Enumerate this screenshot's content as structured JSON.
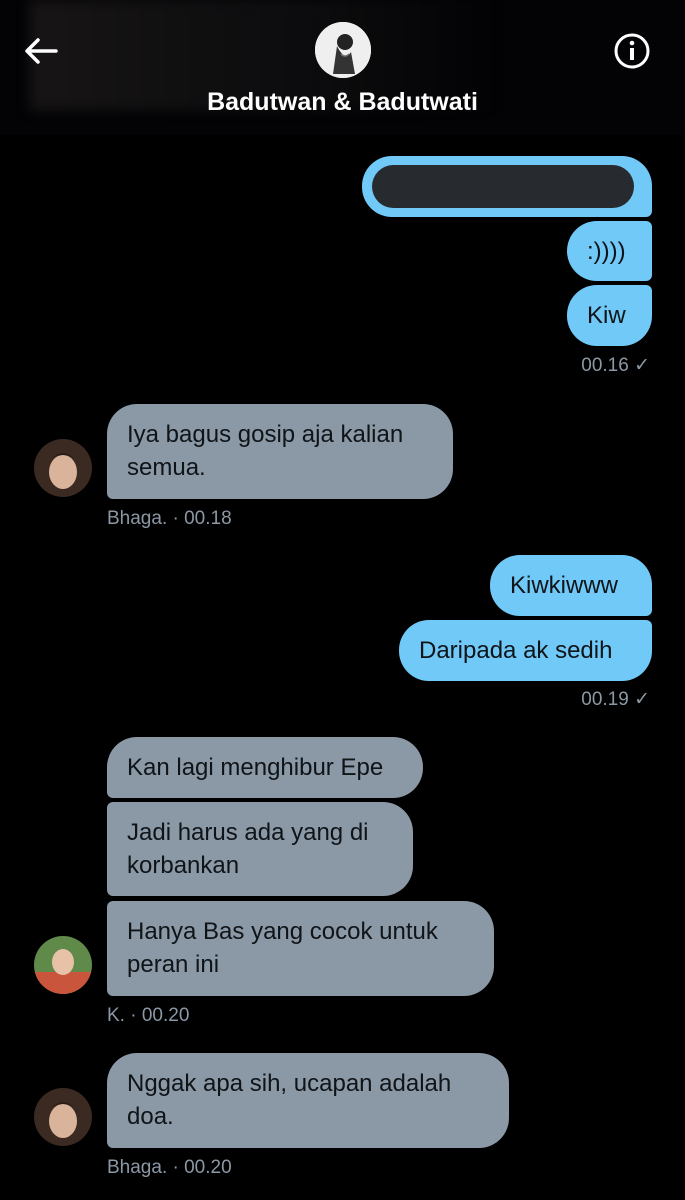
{
  "header": {
    "title": "Badutwan & Badutwati"
  },
  "messages": {
    "out1_text": ":))))",
    "out2_text": "Kiw",
    "time1": "00.16 ✓",
    "in1_text": "Iya bagus gosip aja kalian semua.",
    "in1_meta": "Bhaga. · 00.18",
    "out3_text": "Kiwkiwww",
    "out4_text": "Daripada ak sedih",
    "time2": "00.19 ✓",
    "in2_text": "Kan lagi menghibur Epe",
    "in3_text": "Jadi harus ada yang di korbankan",
    "in4_text": "Hanya Bas yang cocok untuk peran ini",
    "in4_meta": "K. · 00.20",
    "in5_text": "Nggak apa sih, ucapan adalah doa.",
    "in5_meta": "Bhaga. · 00.20"
  },
  "colors": {
    "outgoing_bubble": "#71c9f8",
    "incoming_bubble": "#8b98a5",
    "background": "#000000"
  }
}
